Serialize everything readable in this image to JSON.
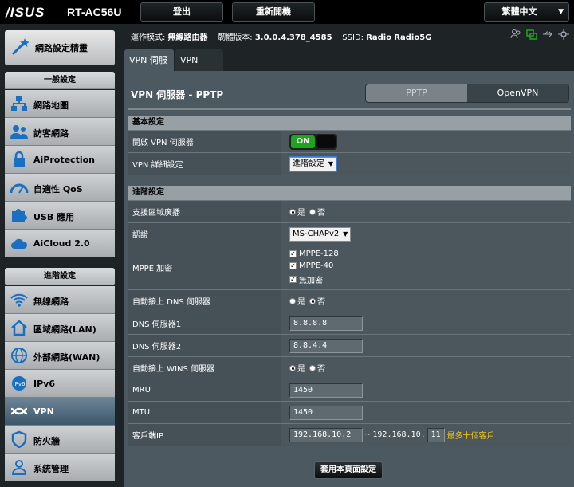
{
  "header": {
    "brand": "/ISUS",
    "model": "RT-AC56U",
    "logout": "登出",
    "reboot": "重新開機",
    "language": "繁體中文"
  },
  "sidebar": {
    "quick_setup": "網路設定精靈",
    "general_title": "一般設定",
    "general_items": [
      {
        "label": "網路地圖",
        "icon": "network-map-icon"
      },
      {
        "label": "訪客網路",
        "icon": "guest-network-icon"
      },
      {
        "label": "AiProtection",
        "icon": "lock-icon"
      },
      {
        "label": "自適性 QoS",
        "icon": "gauge-icon"
      },
      {
        "label": "USB 應用",
        "icon": "puzzle-icon"
      },
      {
        "label": "AiCloud 2.0",
        "icon": "cloud-icon"
      }
    ],
    "advanced_title": "進階設定",
    "advanced_items": [
      {
        "label": "無線網路",
        "icon": "wifi-icon"
      },
      {
        "label": "區域網路(LAN)",
        "icon": "home-icon"
      },
      {
        "label": "外部網路(WAN)",
        "icon": "globe-icon"
      },
      {
        "label": "IPv6",
        "icon": "ipv6-icon"
      },
      {
        "label": "VPN",
        "icon": "vpn-icon"
      },
      {
        "label": "防火牆",
        "icon": "shield-icon"
      },
      {
        "label": "系統管理",
        "icon": "user-icon"
      }
    ]
  },
  "info": {
    "mode_label": "運作模式:",
    "mode_value": "無線路由器",
    "fw_label": "韌體版本:",
    "fw_value": "3.0.0.4.378_4585",
    "ssid_label": "SSID:",
    "ssid_1": "Radio",
    "ssid_2": "Radio5G"
  },
  "tabs": [
    "VPN 伺服器",
    "VPN Client"
  ],
  "panel": {
    "title": "VPN 伺服器 - PPTP",
    "seg_pptp": "PPTP",
    "seg_openvpn": "OpenVPN",
    "basic_title": "基本設定",
    "enable_label": "開啟 VPN 伺服器",
    "enable_value": "ON",
    "detail_label": "VPN 詳細設定",
    "detail_value": "進階設定",
    "advanced_title": "進階設定",
    "broadcast_label": "支援區域廣播",
    "yes": "是",
    "no": "否",
    "auth_label": "認證",
    "auth_value": "MS-CHAPv2",
    "mppe_label": "MPPE 加密",
    "mppe_128": "MPPE-128",
    "mppe_40": "MPPE-40",
    "mppe_none": "無加密",
    "auto_dns_label": "自動接上 DNS 伺服器",
    "dns1_label": "DNS 伺服器1",
    "dns1_value": "8.8.8.8",
    "dns2_label": "DNS 伺服器2",
    "dns2_value": "8.8.4.4",
    "auto_wins_label": "自動接上 WINS 伺服器",
    "mru_label": "MRU",
    "mru_value": "1450",
    "mtu_label": "MTU",
    "mtu_value": "1450",
    "client_ip_label": "客戶端IP",
    "client_ip_start": "192.168.10.2",
    "client_ip_sep": "~",
    "client_ip_end_prefix": "192.168.10.",
    "client_ip_end": "11",
    "client_note": "最多十個客戶",
    "apply": "套用本頁面設定"
  },
  "colors": {
    "accent_green": "#1ea51e",
    "note_yellow": "#ffcc00",
    "active_menu": "#3c566b"
  }
}
